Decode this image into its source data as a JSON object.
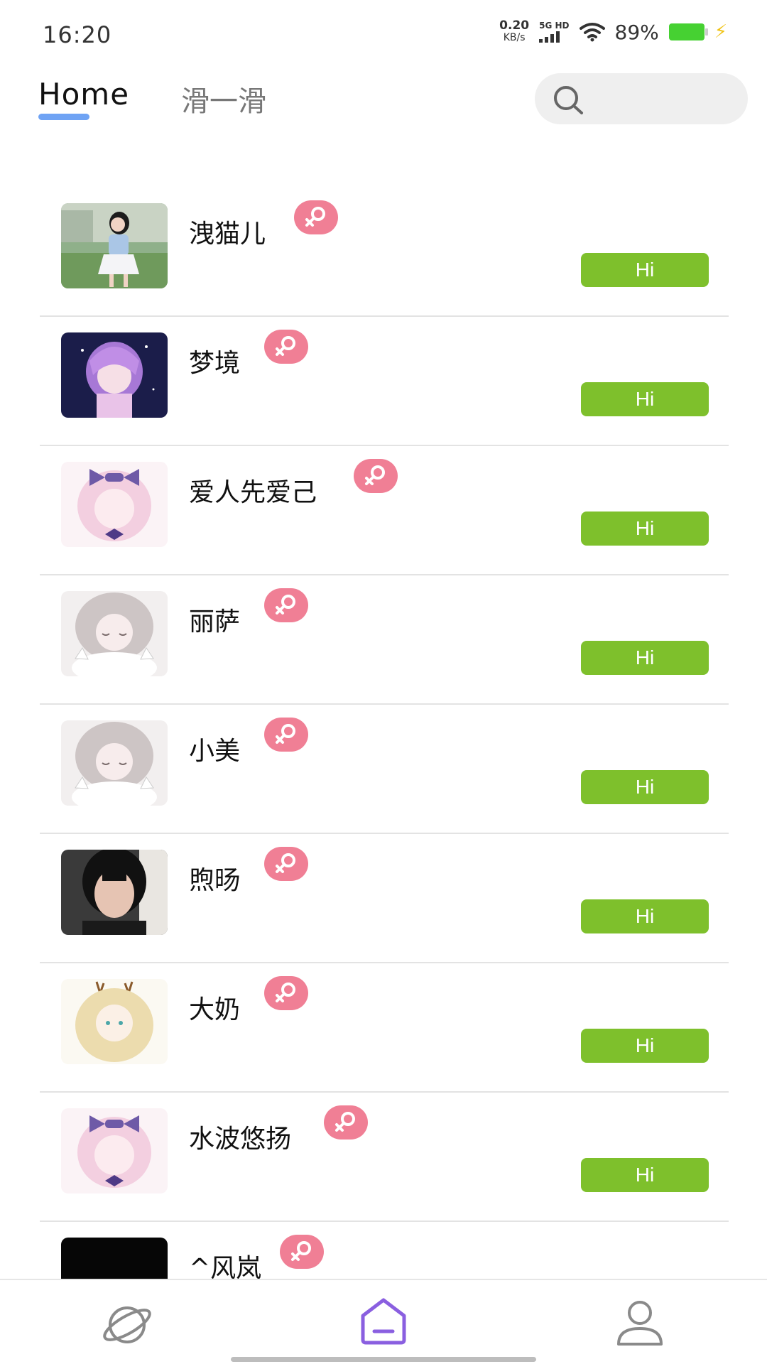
{
  "status": {
    "time": "16:20",
    "net_speed": "0.20",
    "net_unit": "KB/s",
    "signal_label": "5G HD",
    "battery": "89%",
    "battery_color": "#46d132"
  },
  "header": {
    "tabs": [
      "Home",
      "滑一滑"
    ],
    "active_tab": "Home",
    "search": {
      "icon": "search-icon",
      "placeholder": ""
    }
  },
  "users": [
    {
      "name": "洩猫儿",
      "gender_icon": "female-icon",
      "action": "Hi",
      "avatar": "photo-girl-outdoor"
    },
    {
      "name": "梦境",
      "gender_icon": "female-icon",
      "action": "Hi",
      "avatar": "anime-purple-hair"
    },
    {
      "name": "爱人先爱己",
      "gender_icon": "female-icon",
      "action": "Hi",
      "avatar": "anime-pink-bow"
    },
    {
      "name": "丽萨",
      "gender_icon": "female-icon",
      "action": "Hi",
      "avatar": "anime-sleeping-cat"
    },
    {
      "name": "小美",
      "gender_icon": "female-icon",
      "action": "Hi",
      "avatar": "anime-sleeping-cat"
    },
    {
      "name": "煦旸",
      "gender_icon": "female-icon",
      "action": "Hi",
      "avatar": "photo-short-hair"
    },
    {
      "name": "大奶",
      "gender_icon": "female-icon",
      "action": "Hi",
      "avatar": "anime-blonde-antlers"
    },
    {
      "name": "水波悠扬",
      "gender_icon": "female-icon",
      "action": "Hi",
      "avatar": "anime-pink-bow"
    },
    {
      "name": "^风岚",
      "gender_icon": "female-icon",
      "action": "",
      "avatar": "black-square"
    }
  ],
  "nav": [
    {
      "icon": "planet-icon",
      "active": false
    },
    {
      "icon": "home-icon",
      "active": true
    },
    {
      "icon": "profile-icon",
      "active": false
    }
  ],
  "colors": {
    "hi_button": "#7ec02c",
    "gender_badge": "#f07f95",
    "tab_underline": "#6fa3f4",
    "nav_active": "#8a5fe0",
    "nav_inactive": "#8a8a8a"
  }
}
